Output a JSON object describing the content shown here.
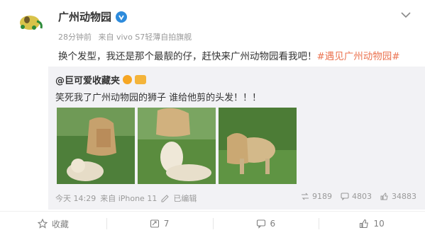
{
  "post": {
    "author": "广州动物园",
    "avatar_label": "广州动物园",
    "time": "28分钟前",
    "source": "来自 vivo S7轻薄自拍旗舰",
    "text": "换个发型，我还是那个最靓的仔，赶快来广州动物园看我吧！",
    "hashtag": "#遇见广州动物园#"
  },
  "repost": {
    "author": "@巨可爱收藏夹",
    "text": "笑死我了广州动物园的狮子 谁给他剪的头发！！！",
    "time": "今天 14:29",
    "source": "来自 iPhone 11",
    "edited_label": "已编辑",
    "reposts": "9189",
    "comments": "4803",
    "likes": "34883"
  },
  "actions": {
    "favorite": "收藏",
    "repost": "7",
    "comment": "6",
    "like": "10"
  },
  "icons": [
    "verified-icon",
    "chevron-down-icon",
    "repost-icon",
    "comment-icon",
    "like-icon",
    "favorite-icon",
    "edit-icon"
  ],
  "colors": {
    "hashtag": "#eb7350",
    "verified": "#2d8bdc",
    "repost_bg": "#f2f2f5"
  }
}
